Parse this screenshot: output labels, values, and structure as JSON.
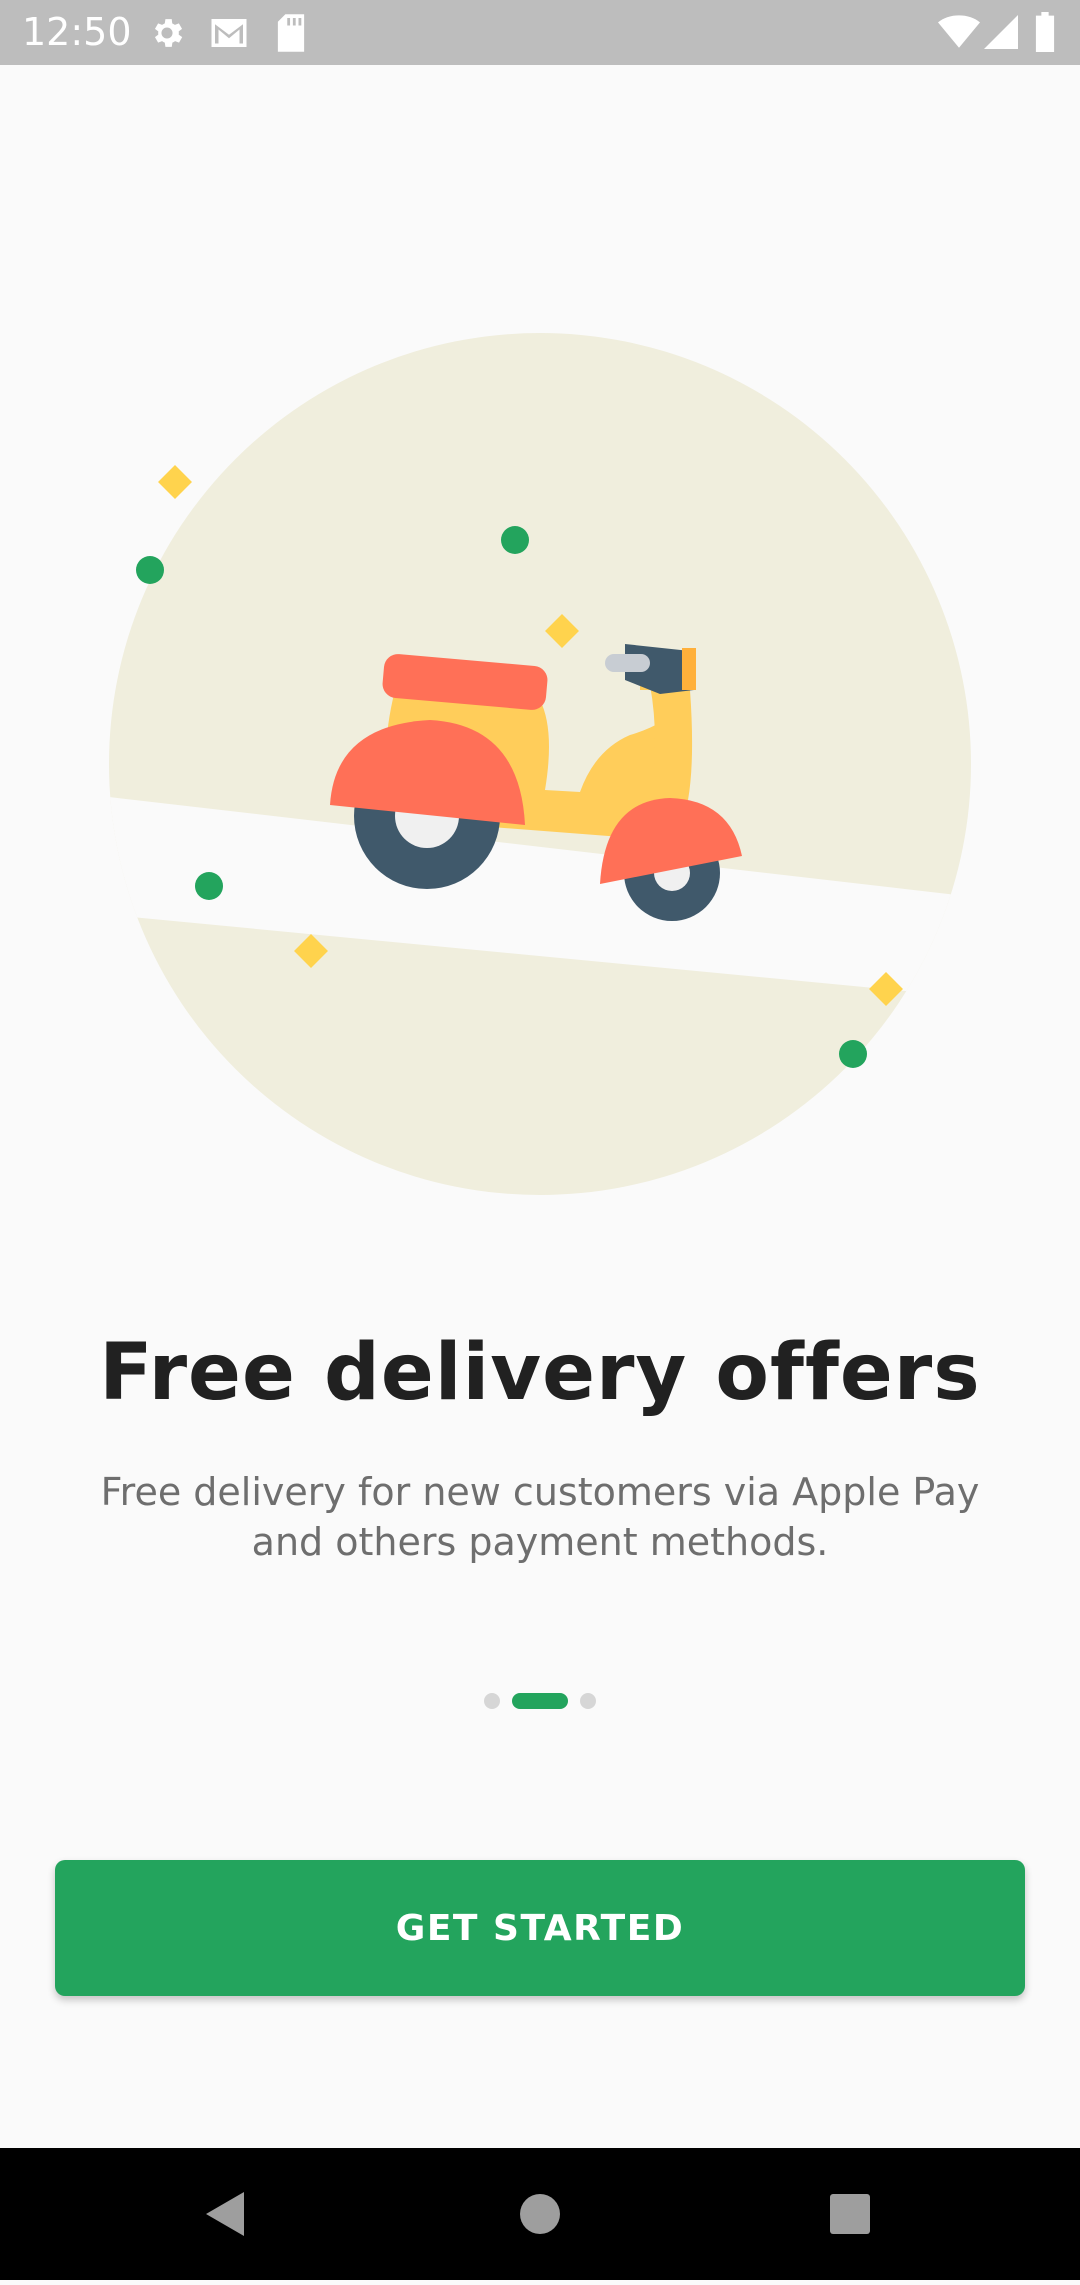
{
  "status_bar": {
    "time": "12:50",
    "icons": [
      "gear-icon",
      "gmail-icon",
      "sd-card-icon",
      "wifi-icon",
      "cell-signal-icon",
      "battery-icon"
    ]
  },
  "onboarding": {
    "illustration": "delivery-scooter",
    "title": "Free delivery offers",
    "subtitle": "Free delivery for new customers via Apple Pay and others payment methods.",
    "page_indicator": {
      "count": 3,
      "active_index": 1
    },
    "cta_label": "GET STARTED"
  },
  "nav_bar": {
    "buttons": [
      "back-icon",
      "home-icon",
      "recents-icon"
    ]
  },
  "colors": {
    "accent": "#23a45d",
    "scooter_red": "#ff7057",
    "scooter_yellow": "#ffcd5a",
    "tire": "#40596b",
    "backdrop": "#f0eedd"
  }
}
